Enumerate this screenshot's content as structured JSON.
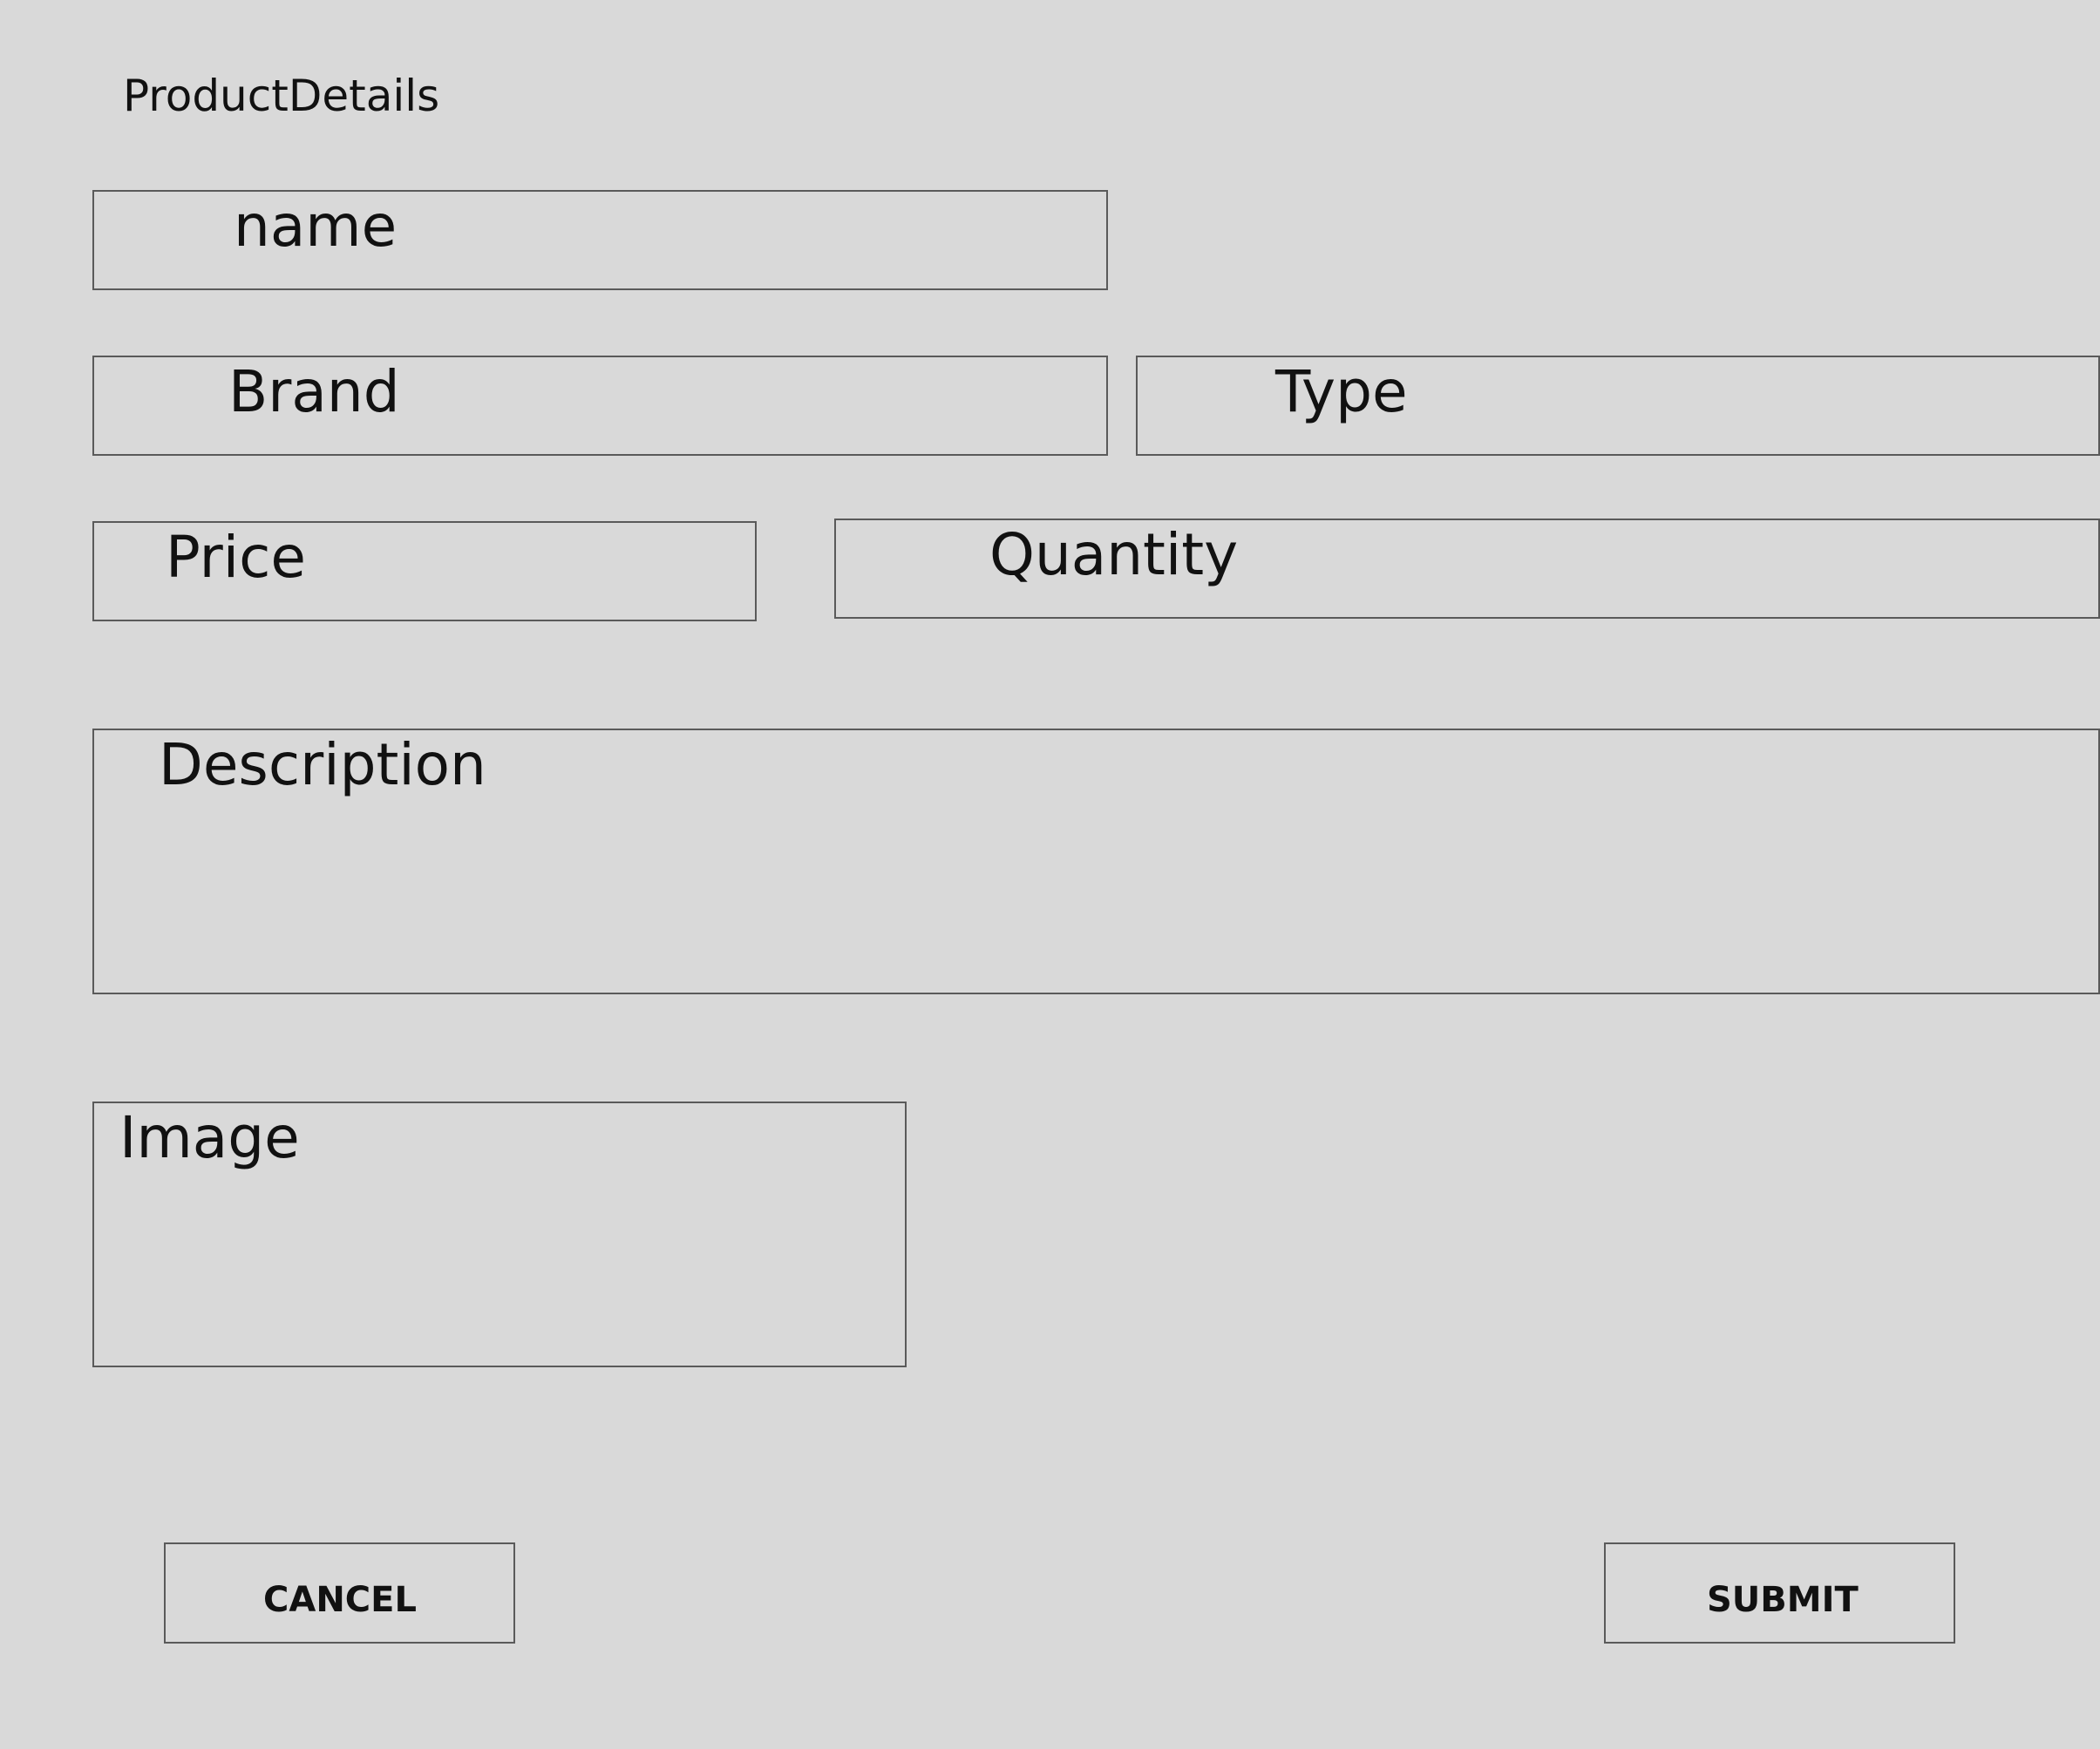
{
  "form": {
    "title": "ProductDetails",
    "fields": {
      "name": {
        "label": "name",
        "value": ""
      },
      "brand": {
        "label": "Brand",
        "value": ""
      },
      "type": {
        "label": "Type",
        "value": ""
      },
      "price": {
        "label": "Price",
        "value": ""
      },
      "quantity": {
        "label": "Quantity",
        "value": ""
      },
      "description": {
        "label": "Description",
        "value": ""
      },
      "image": {
        "label": "Image",
        "value": ""
      }
    },
    "actions": {
      "cancel_label": "CANCEL",
      "submit_label": "SUBMIT"
    },
    "colors": {
      "background": "#d9d9d9",
      "border": "#5a5a5a",
      "text": "#111111"
    }
  }
}
